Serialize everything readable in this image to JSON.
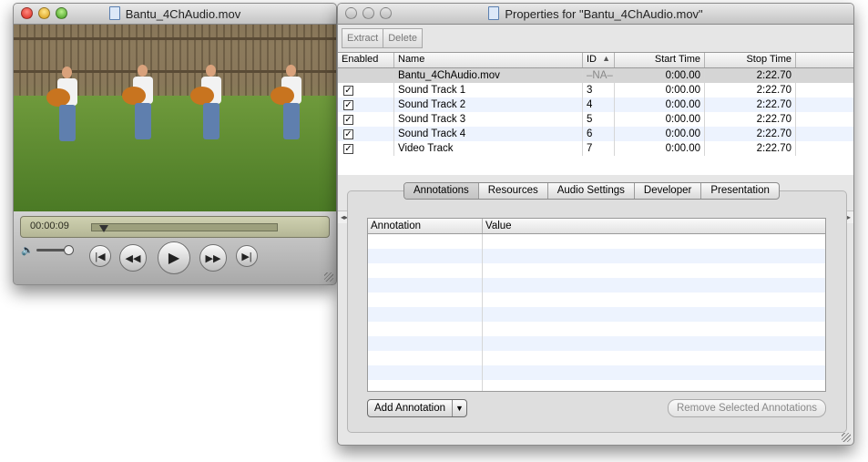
{
  "player": {
    "title": "Bantu_4ChAudio.mov",
    "timecode": "00:00:09",
    "playhead_fraction": 0.065,
    "volume_fraction": 0.85
  },
  "props": {
    "title": "Properties for \"Bantu_4ChAudio.mov\"",
    "toolbar": {
      "extract": "Extract",
      "delete": "Delete"
    },
    "columns": {
      "enabled": "Enabled",
      "name": "Name",
      "id": "ID",
      "start": "Start Time",
      "stop": "Stop Time"
    },
    "tracks": [
      {
        "enabled": false,
        "name": "Bantu_4ChAudio.mov",
        "id": "–NA–",
        "start": "0:00.00",
        "stop": "2:22.70"
      },
      {
        "enabled": true,
        "name": "Sound Track 1",
        "id": "3",
        "start": "0:00.00",
        "stop": "2:22.70"
      },
      {
        "enabled": true,
        "name": "Sound Track 2",
        "id": "4",
        "start": "0:00.00",
        "stop": "2:22.70"
      },
      {
        "enabled": true,
        "name": "Sound Track 3",
        "id": "5",
        "start": "0:00.00",
        "stop": "2:22.70"
      },
      {
        "enabled": true,
        "name": "Sound Track 4",
        "id": "6",
        "start": "0:00.00",
        "stop": "2:22.70"
      },
      {
        "enabled": true,
        "name": "Video Track",
        "id": "7",
        "start": "0:00.00",
        "stop": "2:22.70"
      }
    ],
    "tabs": [
      "Annotations",
      "Resources",
      "Audio Settings",
      "Developer",
      "Presentation"
    ],
    "selected_tab": "Annotations",
    "annotation_columns": {
      "annotation": "Annotation",
      "value": "Value"
    },
    "add_annotation": "Add Annotation",
    "remove_annotations": "Remove Selected Annotations"
  }
}
